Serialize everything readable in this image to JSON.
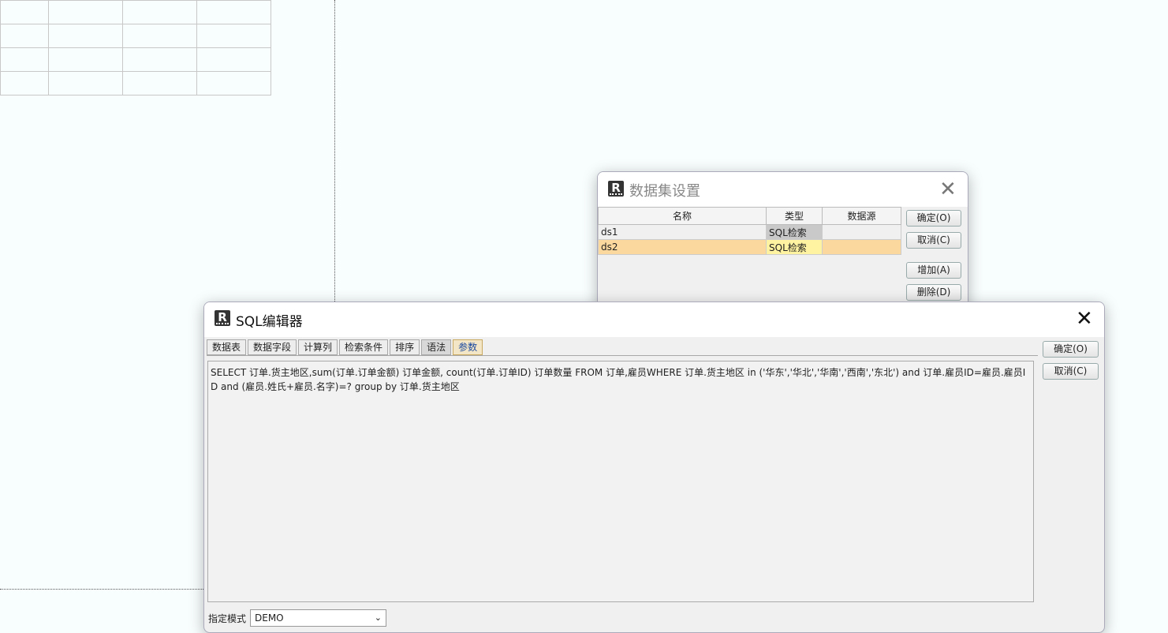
{
  "dataset_dialog": {
    "title": "数据集设置",
    "columns": [
      "名称",
      "类型",
      "数据源"
    ],
    "rows": [
      {
        "name": "ds1",
        "type": "SQL检索",
        "source": ""
      },
      {
        "name": "ds2",
        "type": "SQL检索",
        "source": ""
      }
    ],
    "buttons": {
      "ok": "确定(O)",
      "cancel": "取消(C)",
      "add": "增加(A)",
      "delete": "删除(D)"
    }
  },
  "sql_editor": {
    "title": "SQL编辑器",
    "tabs": [
      "数据表",
      "数据字段",
      "计算列",
      "检索条件",
      "排序",
      "语法",
      "参数"
    ],
    "active_tab": "语法",
    "sql_text": "SELECT 订单.货主地区,sum(订单.订单金额) 订单金额, count(订单.订单ID) 订单数量 FROM 订单,雇员WHERE 订单.货主地区 in ('华东','华北','华南','西南','东北') and 订单.雇员ID=雇员.雇员ID and (雇员.姓氏+雇员.名字)=? group by 订单.货主地区",
    "buttons": {
      "ok": "确定(O)",
      "cancel": "取消(C)"
    },
    "mode_label": "指定模式",
    "mode_value": "DEMO"
  },
  "colors": {
    "selected_row": "#fbd89d",
    "type_cell_selected": "#fff2a0",
    "type_cell_gray": "#c9c9c9"
  }
}
